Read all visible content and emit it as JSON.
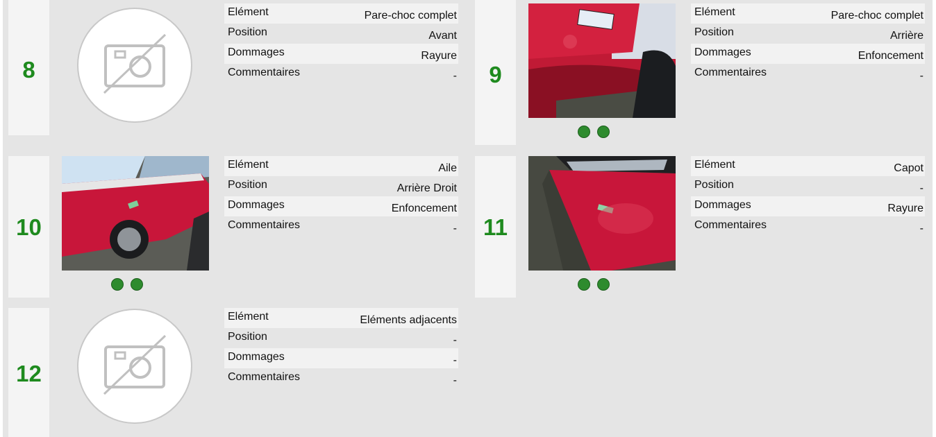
{
  "labels": {
    "element": "Elément",
    "position": "Position",
    "damages": "Dommages",
    "comments": "Commentaires"
  },
  "colors": {
    "number": "#1e8a1e",
    "dot": "#2e8b2e",
    "background": "#e5e5e5",
    "number_column": "#f4f4f4",
    "row_shade": "#f2f2f2"
  },
  "damages": [
    {
      "number": "8",
      "element": "Pare-choc complet",
      "position": "Avant",
      "damages": "Rayure",
      "comments": "-",
      "has_photo": false,
      "photo_dots": 0,
      "photo_icon": "no-photo-icon"
    },
    {
      "number": "9",
      "element": "Pare-choc complet",
      "position": "Arrière",
      "damages": "Enfoncement",
      "comments": "-",
      "has_photo": true,
      "photo_dots": 2,
      "photo_icon": "car-photo"
    },
    {
      "number": "10",
      "element": "Aile",
      "position": "Arrière Droit",
      "damages": "Enfoncement",
      "comments": "-",
      "has_photo": true,
      "photo_dots": 2,
      "photo_icon": "car-photo"
    },
    {
      "number": "11",
      "element": "Capot",
      "position": "-",
      "damages": "Rayure",
      "comments": "-",
      "has_photo": true,
      "photo_dots": 2,
      "photo_icon": "car-photo"
    },
    {
      "number": "12",
      "element": "Eléments adjacents",
      "position": "-",
      "damages": "-",
      "comments": "-",
      "has_photo": false,
      "photo_dots": 0,
      "photo_icon": "no-photo-icon"
    }
  ]
}
